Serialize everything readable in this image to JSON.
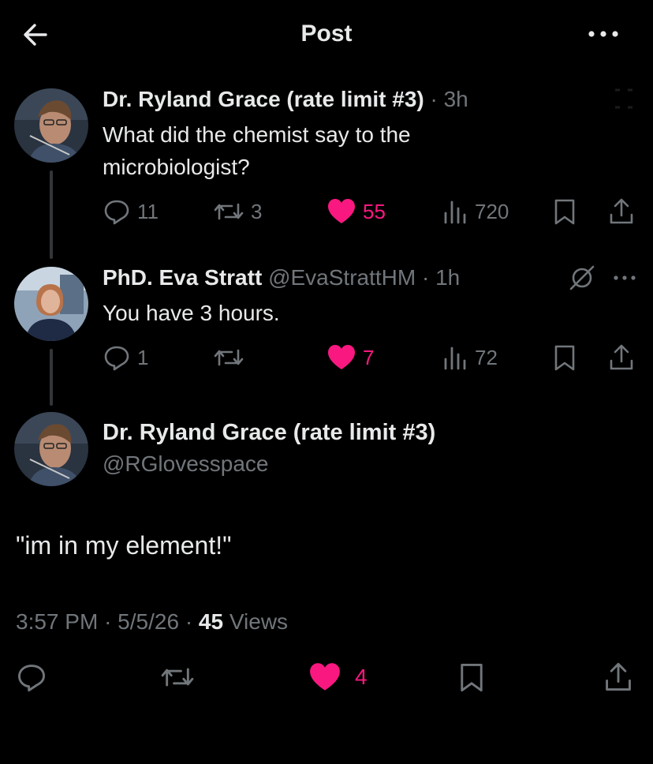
{
  "header": {
    "title": "Post",
    "back_icon": "arrow-left-icon",
    "more_icon": "more-horizontal-icon"
  },
  "thread": [
    {
      "author_name": "Dr. Ryland Grace (rate limit #3)",
      "time": "· 3h",
      "lines": [
        "What did the chemist say to the",
        "microbiologist?"
      ],
      "replies": "11",
      "reposts": "3",
      "likes": "55",
      "views": "720"
    },
    {
      "author_name": "PhD. Eva Stratt",
      "handle": "@EvaStrattHM",
      "time": "· 1h",
      "text": "You have 3 hours.",
      "replies": "1",
      "reposts": "",
      "likes": "7",
      "views": "72"
    }
  ],
  "main_post": {
    "author_name": "Dr. Ryland Grace (rate limit #3)",
    "handle": "@RGlovesspace",
    "text": "\"im in my element!\"",
    "time": "3:57 PM",
    "date": "5/5/26",
    "separator": "·",
    "views_count": "45",
    "views_label": "Views",
    "likes": "4"
  },
  "colors": {
    "background": "#000000",
    "text": "#e7e9ea",
    "muted": "#71767b",
    "like_pink": "#f91880"
  }
}
